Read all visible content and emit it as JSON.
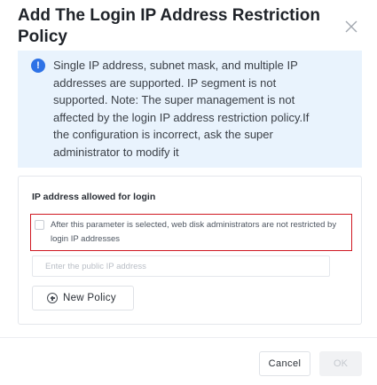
{
  "dialog": {
    "title": "Add The Login IP Address Restriction Policy",
    "close_icon": "close-icon"
  },
  "notice": {
    "icon": "info-icon",
    "icon_glyph": "!",
    "text": "Single IP address, subnet mask, and multiple IP addresses are supported. IP segment is not supported. Note: The super management is not affected by the login IP address restriction policy.If the configuration is incorrect, ask the super administrator to modify it"
  },
  "ip_section": {
    "label": "IP address allowed for login",
    "option_text": "After this parameter is selected, web disk administrators are not restricted by login IP addresses",
    "option_checked": false,
    "input_placeholder": "Enter the public IP address",
    "input_value": "",
    "new_policy_label": "New Policy",
    "new_policy_icon": "plus-circle-icon"
  },
  "footer": {
    "cancel_label": "Cancel",
    "ok_label": "OK"
  },
  "colors": {
    "info_background": "#e9f3fd",
    "info_icon": "#2e72e6",
    "highlight_border": "#d01822"
  }
}
